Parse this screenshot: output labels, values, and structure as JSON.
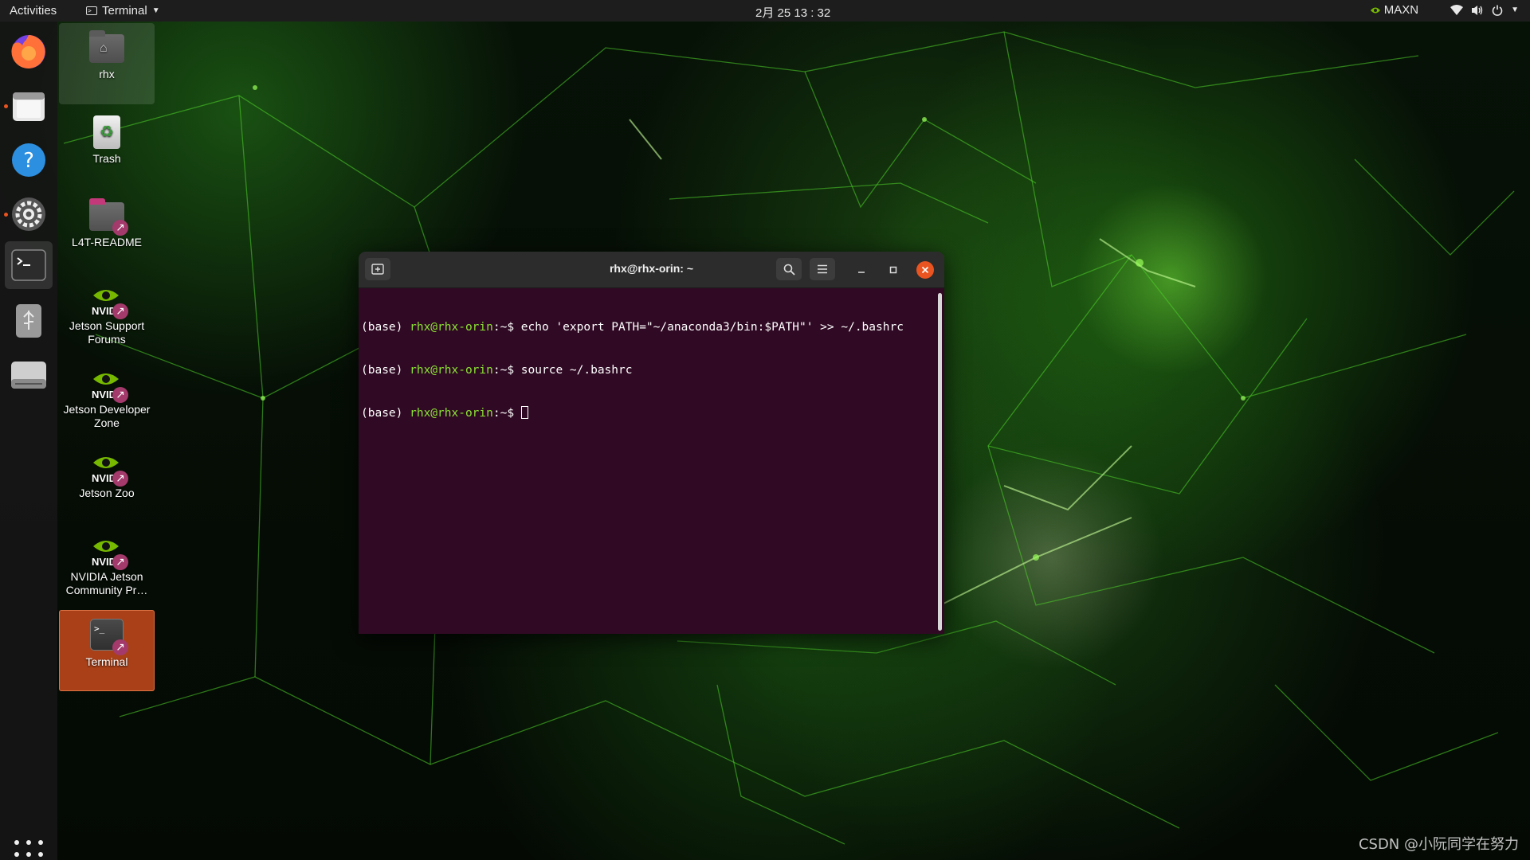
{
  "topbar": {
    "activities": "Activities",
    "app_menu": "Terminal",
    "clock": "2月 25  13 : 32",
    "power_mode": "MAXN",
    "icons": [
      "nvidia-icon",
      "wifi-icon",
      "volume-icon",
      "power-icon",
      "chevron-down-icon"
    ]
  },
  "dock": {
    "items": [
      "firefox-icon",
      "files-icon",
      "help-icon",
      "settings-icon",
      "terminal-icon",
      "usb-drive-icon",
      "disk-drive-icon"
    ],
    "show_apps": "apps-grid-icon"
  },
  "desktop": {
    "icons": [
      {
        "label": "rhx",
        "icon": "home-folder-icon"
      },
      {
        "label": "Trash",
        "icon": "trash-icon"
      },
      {
        "label": "L4T-README",
        "icon": "folder-link-icon"
      },
      {
        "label": "Jetson Support Forums",
        "icon": "nvidia-icon"
      },
      {
        "label": "Jetson Developer Zone",
        "icon": "nvidia-icon"
      },
      {
        "label": "Jetson Zoo",
        "icon": "nvidia-icon"
      },
      {
        "label": "NVIDIA Jetson Community Pr…",
        "icon": "nvidia-icon"
      },
      {
        "label": "Terminal",
        "icon": "terminal-icon"
      }
    ]
  },
  "terminal": {
    "title": "rhx@rhx-orin: ~",
    "lines": [
      {
        "env": "(base) ",
        "user": "rhx@rhx-orin",
        "path": ":~$ ",
        "cmd": "echo 'export PATH=\"~/anaconda3/bin:$PATH\"' >> ~/.bashrc"
      },
      {
        "env": "(base) ",
        "user": "rhx@rhx-orin",
        "path": ":~$ ",
        "cmd": "source ~/.bashrc"
      },
      {
        "env": "(base) ",
        "user": "rhx@rhx-orin",
        "path": ":~$ ",
        "cmd": ""
      }
    ]
  },
  "watermark": "CSDN @小阮同学在努力",
  "colors": {
    "accent": "#e95420",
    "terminal_bg": "#300a24",
    "prompt_user": "#8ae234",
    "topbar_bg": "#1d1d1d"
  }
}
